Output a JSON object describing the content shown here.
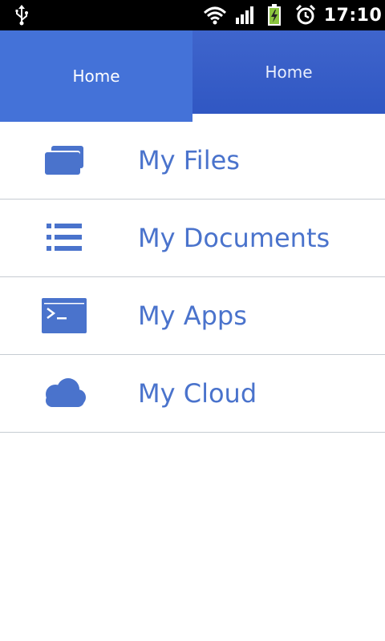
{
  "status_bar": {
    "time": "17:10",
    "icons": [
      "usb-icon",
      "wifi-icon",
      "signal-icon",
      "battery-charging-icon",
      "alarm-icon"
    ]
  },
  "tabs": [
    {
      "label": "Home",
      "active": true
    },
    {
      "label": "Home",
      "active": false
    }
  ],
  "menu": [
    {
      "label": "My Files",
      "icon": "folder-icon"
    },
    {
      "label": "My Documents",
      "icon": "list-icon"
    },
    {
      "label": "My Apps",
      "icon": "terminal-icon"
    },
    {
      "label": "My Cloud",
      "icon": "cloud-icon"
    }
  ],
  "colors": {
    "accent": "#4a73cc",
    "tab_active": "#4472d8",
    "tab_inactive": "#3057c3",
    "status_bar": "#000000",
    "battery": "#8bc53f"
  }
}
